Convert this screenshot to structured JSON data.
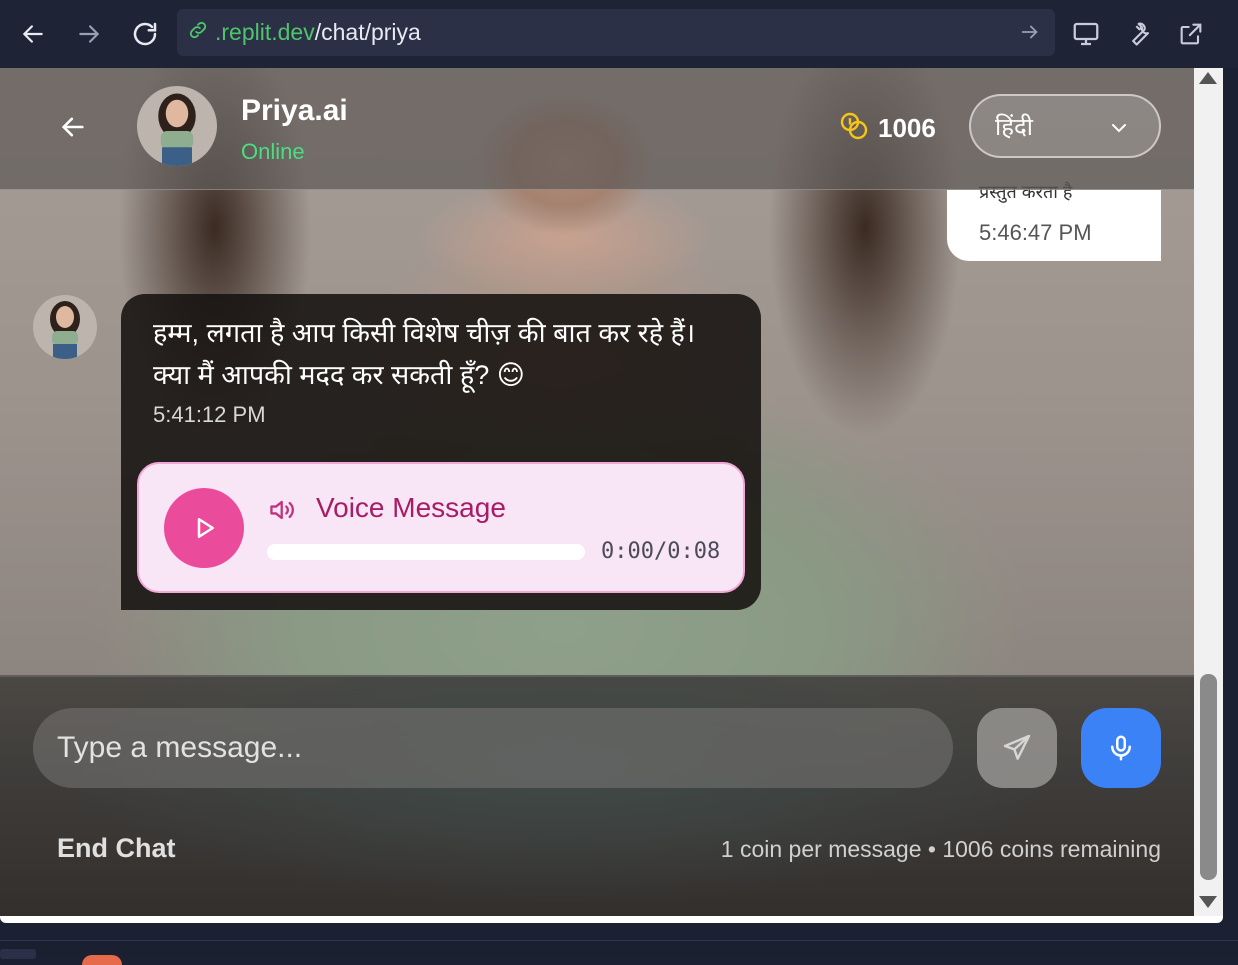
{
  "browser": {
    "url_domain": ".replit.dev",
    "url_path": "/chat/priya"
  },
  "header": {
    "name": "Priya.ai",
    "status": "Online",
    "coins": "1006",
    "language": "हिंदी"
  },
  "messages": {
    "user": {
      "text_cut": "प्रस्तुत करता है",
      "time": "5:46:47 PM"
    },
    "ai": {
      "text": "हम्म, लगता है आप किसी विशेष चीज़ की बात कर रहे हैं। क्या मैं आपकी मदद कर सकती हूँ? 😊",
      "time": "5:41:12 PM",
      "voice_title": "Voice Message",
      "voice_time": "0:00/0:08",
      "voice_progress": 0
    }
  },
  "composer": {
    "placeholder": "Type a message...",
    "end_chat": "End Chat",
    "coin_info": "1 coin per message • 1006 coins remaining"
  },
  "colors": {
    "online": "#4ade80",
    "play": "#ea4b9b",
    "mic": "#3b82f6",
    "voice_title": "#a61d66",
    "coin": "#f5c518"
  }
}
